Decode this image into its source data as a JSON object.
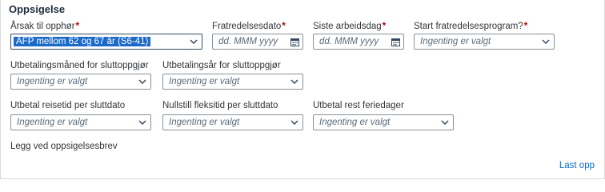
{
  "section": {
    "title": "Oppsigelse"
  },
  "row1": {
    "cause": {
      "label": "Årsak til opphør",
      "required": "*",
      "value": "AFP mellom 62 og 67 år (S6-41)"
    },
    "release_date": {
      "label": "Fratredelsesdato",
      "required": "*",
      "placeholder": "dd. MMM yyyy"
    },
    "last_workday": {
      "label": "Siste arbeidsdag",
      "required": "*",
      "placeholder": "dd. MMM yyyy"
    },
    "program_start": {
      "label": "Start fratredelsesprogram?",
      "required": "*",
      "value": "Ingenting er valgt"
    }
  },
  "row2": {
    "payout_month": {
      "label": "Utbetalingsmåned for sluttoppgjør",
      "value": "Ingenting er valgt"
    },
    "payout_year": {
      "label": "Utbetalingsår for sluttoppgjør",
      "value": "Ingenting er valgt"
    }
  },
  "row3": {
    "travel_days": {
      "label": "Utbetal reisetid per sluttdato",
      "value": "Ingenting er valgt"
    },
    "flex_reset": {
      "label": "Nullstill fleksitid per sluttdato",
      "value": "Ingenting er valgt"
    },
    "vacation_rest": {
      "label": "Utbetal rest feriedager",
      "value": "Ingenting er valgt"
    }
  },
  "attach": {
    "label": "Legg ved oppsigelsesbrev"
  },
  "footer": {
    "link": "Last opp"
  },
  "icons": {
    "dropdown": "chevron-down-icon",
    "date": "calendar-icon"
  },
  "colors": {
    "required": "#bb0000",
    "link": "#0a6ed1",
    "selection": "#1b6ac9"
  }
}
